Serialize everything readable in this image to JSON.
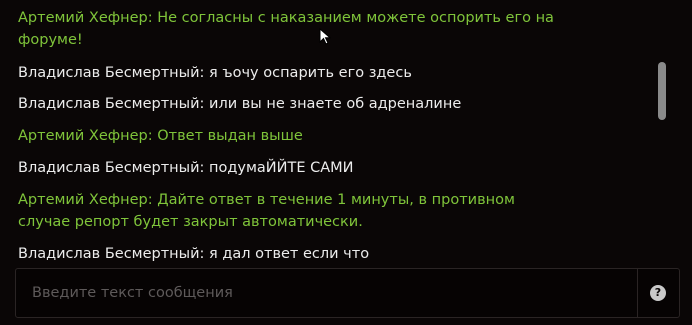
{
  "chat": {
    "messages": [
      {
        "author_type": "admin",
        "text": "Артемий Хефнер: Не согласны с наказанием можете оспорить его на форуме!"
      },
      {
        "author_type": "user",
        "text": "Владислав Бесмертный: я ъочу оспарить его здесь"
      },
      {
        "author_type": "user",
        "text": "Владислав Бесмертный: или вы не знаете об адреналине"
      },
      {
        "author_type": "admin",
        "text": "Артемий Хефнер: Ответ выдан выше"
      },
      {
        "author_type": "user",
        "text": "Владислав Бесмертный: подумаЙЙТЕ САМИ"
      },
      {
        "author_type": "admin",
        "text": "Артемий Хефнер: Дайте ответ в течение 1 минуты, в противном случае репорт будет закрыт автоматически."
      },
      {
        "author_type": "user",
        "text": "Владислав Бесмертный: я дал ответ если что"
      }
    ]
  },
  "input": {
    "placeholder": "Введите текст сообщения",
    "value": ""
  },
  "help": {
    "label": "?"
  },
  "colors": {
    "admin": "#7fc43a",
    "user": "#ececec",
    "background": "#0a0606"
  }
}
